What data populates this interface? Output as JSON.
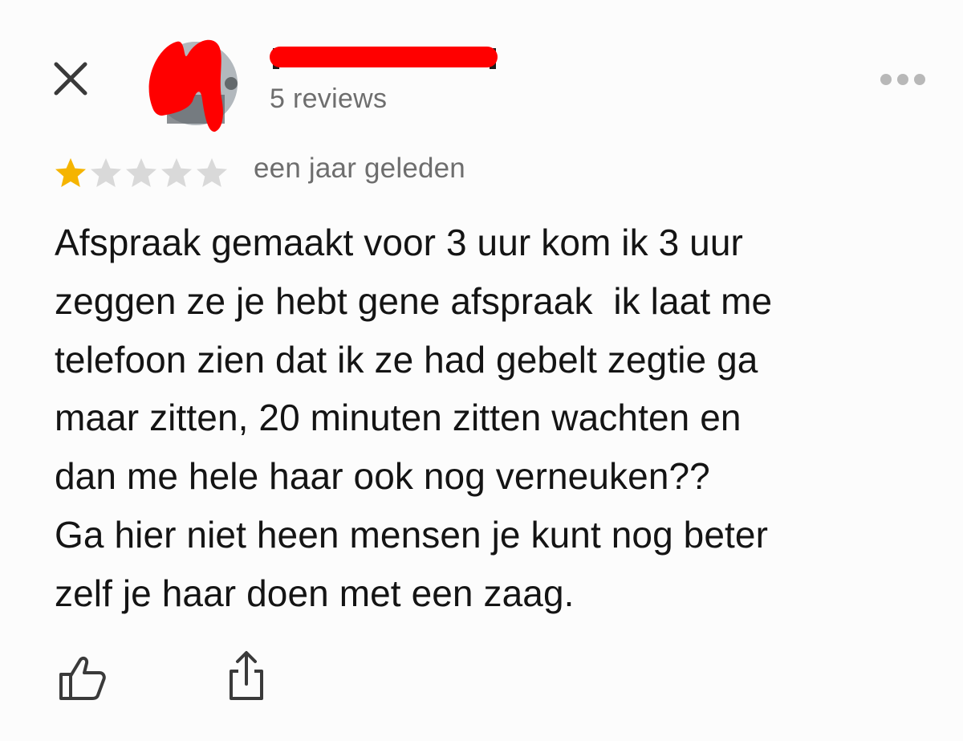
{
  "review": {
    "reviewer": {
      "name": "",
      "review_count_label": "5 reviews"
    },
    "rating": {
      "value": 1,
      "max": 5,
      "filled_color": "#f5b400",
      "empty_color": "#d9d9d9"
    },
    "date": "een jaar geleden",
    "text": "Afspraak gemaakt voor 3 uur kom ik 3 uur\nzeggen ze je hebt gene afspraak  ik laat me\ntelefoon zien dat ik ze had gebelt zegtie ga\nmaar zitten, 20 minuten zitten wachten en\ndan me hele haar ook nog verneuken??\nGa hier niet heen mensen je kunt nog beter\nzelf je haar doen met een zaag."
  },
  "header": {
    "close_icon": "close-icon",
    "more_icon": "more-horizontal-icon"
  },
  "actions": {
    "like_icon": "thumbs-up-icon",
    "share_icon": "share-icon"
  },
  "redaction_color": "#ff0000"
}
